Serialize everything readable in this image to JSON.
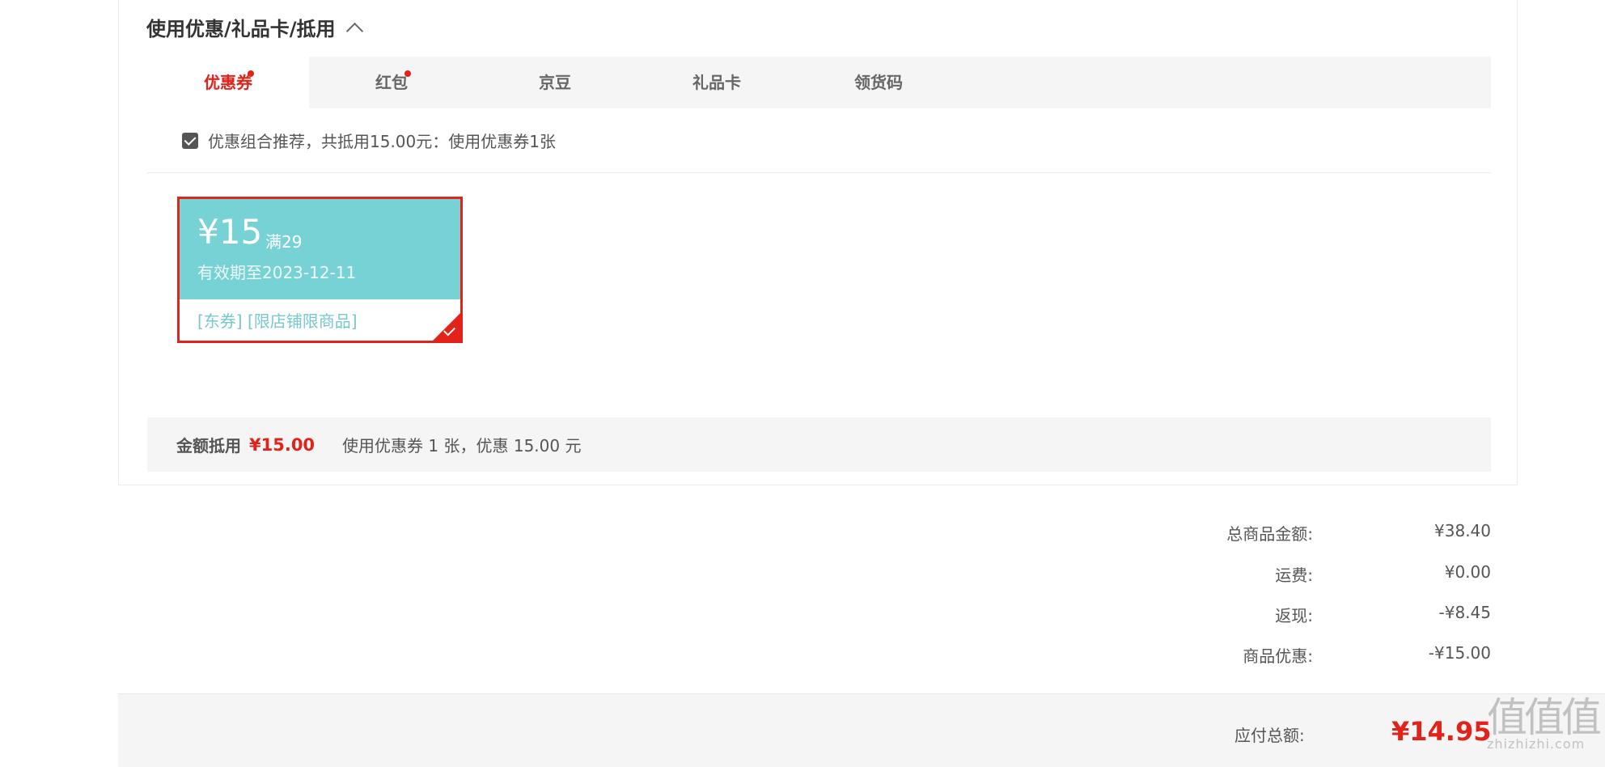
{
  "section": {
    "title": "使用优惠/礼品卡/抵用"
  },
  "tabs": [
    {
      "label": "优惠券",
      "active": true,
      "dot": true
    },
    {
      "label": "红包",
      "active": false,
      "dot": true
    },
    {
      "label": "京豆",
      "active": false,
      "dot": false
    },
    {
      "label": "礼品卡",
      "active": false,
      "dot": false
    },
    {
      "label": "领货码",
      "active": false,
      "dot": false
    }
  ],
  "combo": {
    "checked": true,
    "text": "优惠组合推荐，共抵用15.00元：使用优惠券1张"
  },
  "coupon": {
    "amount": "¥15",
    "condition": "满29",
    "valid": "有效期至2023-12-11",
    "tags": "[东券] [限店铺限商品]",
    "selected": true
  },
  "summary": {
    "label": "金额抵用",
    "amount": "¥15.00",
    "desc": "使用优惠券 1 张，优惠 15.00 元"
  },
  "totals": [
    {
      "label": "总商品金额:",
      "value": "¥38.40"
    },
    {
      "label": "运费:",
      "value": "¥0.00"
    },
    {
      "label": "返现:",
      "value": "-¥8.45"
    },
    {
      "label": "商品优惠:",
      "value": "-¥15.00"
    }
  ],
  "payable": {
    "label": "应付总额:",
    "value": "¥14.95"
  },
  "watermark": {
    "glyphs": "值值值",
    "url": "zhizhizhi.com"
  },
  "colors": {
    "accent": "#e2231a",
    "coupon_bg": "#77d2d6",
    "bar_bg": "#f5f5f5"
  }
}
